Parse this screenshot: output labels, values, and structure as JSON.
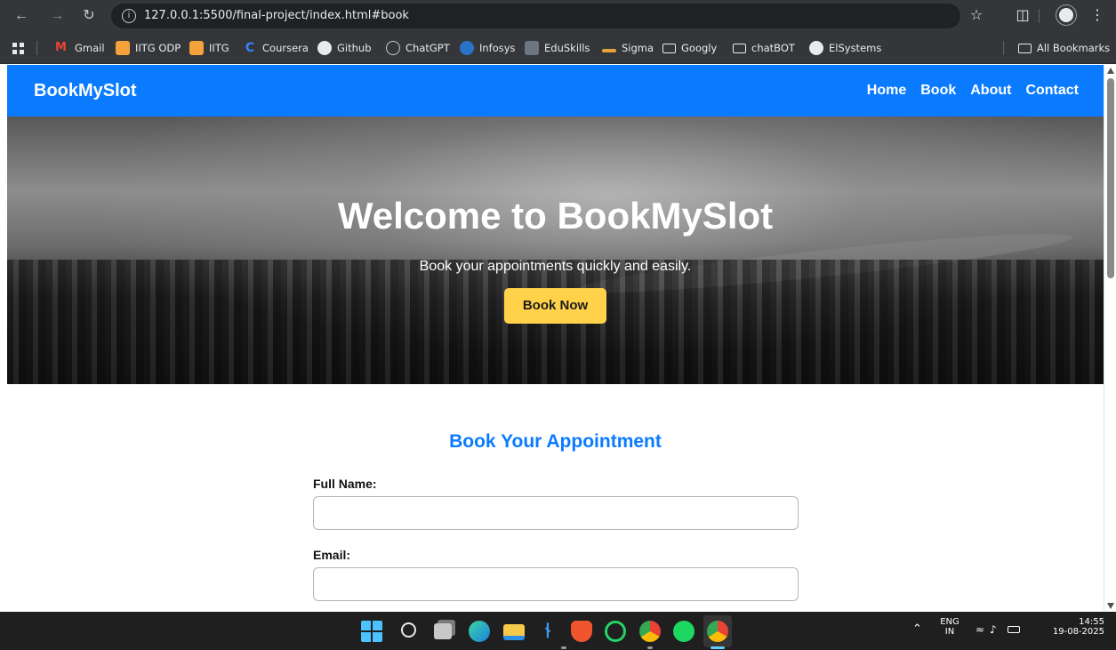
{
  "browser": {
    "url": "127.0.0.1:5500/final-project/index.html#book",
    "icons": [
      "back-arrow-icon",
      "forward-arrow-icon",
      "reload-icon",
      "site-info-icon",
      "star-icon",
      "extensions-icon",
      "menu-dots-icon"
    ]
  },
  "bookmarks": [
    {
      "label": "Gmail",
      "color": "#ea4335"
    },
    {
      "label": "IITG ODP",
      "color": "#f4a33b"
    },
    {
      "label": "IITG",
      "color": "#f4a33b"
    },
    {
      "label": "Coursera",
      "color": "#0056d2"
    },
    {
      "label": "Github",
      "color": "#e8eaed"
    },
    {
      "label": "ChatGPT",
      "color": "#9aa0a6"
    },
    {
      "label": "Infosys",
      "color": "#2b72c9"
    },
    {
      "label": "EduSkills",
      "color": "#6b7680"
    },
    {
      "label": "Sigma",
      "color": "#e8a23b"
    },
    {
      "label": "Googly",
      "color": "folder"
    },
    {
      "label": "chatBOT",
      "color": "folder"
    },
    {
      "label": "ElSystems",
      "color": "#e8eaed"
    }
  ],
  "all_bookmarks_label": "All Bookmarks",
  "site": {
    "logo": "BookMySlot",
    "nav": [
      "Home",
      "Book",
      "About",
      "Contact"
    ],
    "hero": {
      "title": "Welcome to BookMySlot",
      "subtitle": "Book your appointments quickly and easily.",
      "button": "Book Now"
    },
    "form": {
      "title": "Book Your Appointment",
      "name_label": "Full Name:",
      "email_label": "Email:"
    },
    "colors": {
      "primary": "#0a7bff",
      "button": "#ffd24a"
    }
  },
  "taskbar": {
    "apps": [
      "windows-start-icon",
      "search-icon",
      "task-view-icon",
      "edge-icon",
      "file-explorer-icon",
      "vscode-icon",
      "brave-icon",
      "whatsapp-icon",
      "chrome-icon",
      "spotify-icon",
      "chrome-active-icon"
    ],
    "tray": {
      "lang_top": "ENG",
      "lang_bottom": "IN",
      "time": "14:55",
      "date": "19-08-2025"
    }
  }
}
